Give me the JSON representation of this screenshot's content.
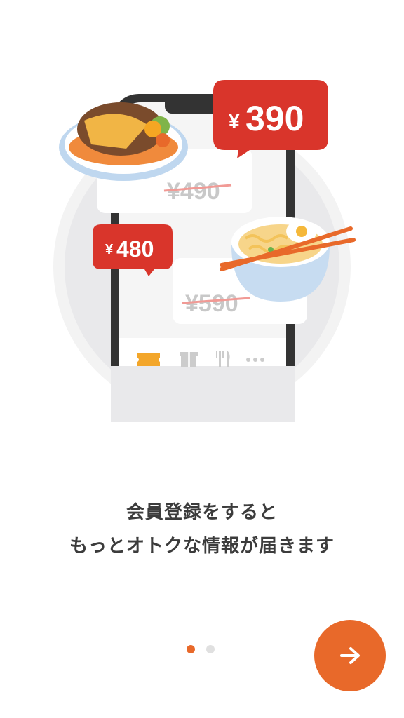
{
  "colors": {
    "accent": "#e8692a",
    "price_tag": "#d9352b",
    "text": "#3c3c3c"
  },
  "illustration": {
    "price_tags": [
      {
        "symbol": "¥",
        "amount": "390"
      },
      {
        "symbol": "¥",
        "amount": "480"
      }
    ],
    "old_prices": [
      "¥490",
      "¥590"
    ],
    "phone_nav_icons": [
      "ticket-icon",
      "gift-icon",
      "cutlery-icon",
      "more-icon"
    ]
  },
  "onboarding": {
    "headline_line1": "会員登録をすると",
    "headline_line2": "もっとオトクな情報が届きます",
    "page_count": 2,
    "current_page": 1
  },
  "next_button": {
    "icon": "arrow-right-icon"
  }
}
